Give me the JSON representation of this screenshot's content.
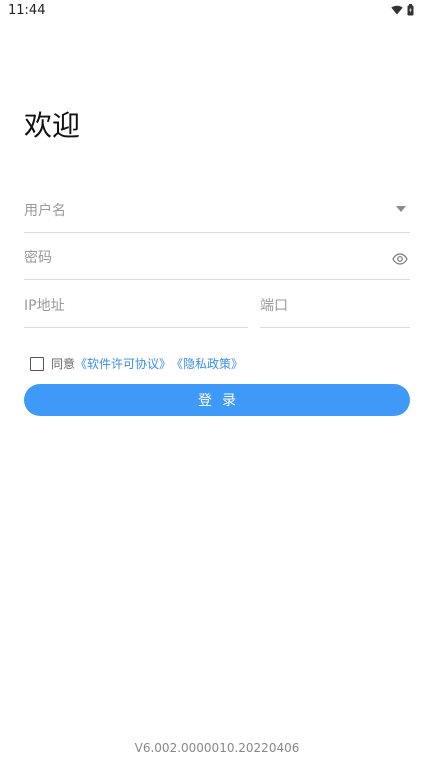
{
  "status_bar": {
    "time": "11:44",
    "icons": [
      "wifi-icon",
      "battery-icon"
    ]
  },
  "title": "欢迎",
  "form": {
    "username_placeholder": "用户名",
    "password_placeholder": "密码",
    "ip_placeholder": "IP地址",
    "port_placeholder": "端口"
  },
  "agreement": {
    "checked": false,
    "prefix": "同意",
    "license_link": "《软件许可协议》",
    "privacy_link": "《隐私政策》"
  },
  "login_label": "登录",
  "version": "V6.002.0000010.20220406",
  "colors": {
    "accent": "#3f99f8",
    "link": "#3a8ee6",
    "divider": "#dcdcdc",
    "placeholder": "#9a9a9a"
  }
}
